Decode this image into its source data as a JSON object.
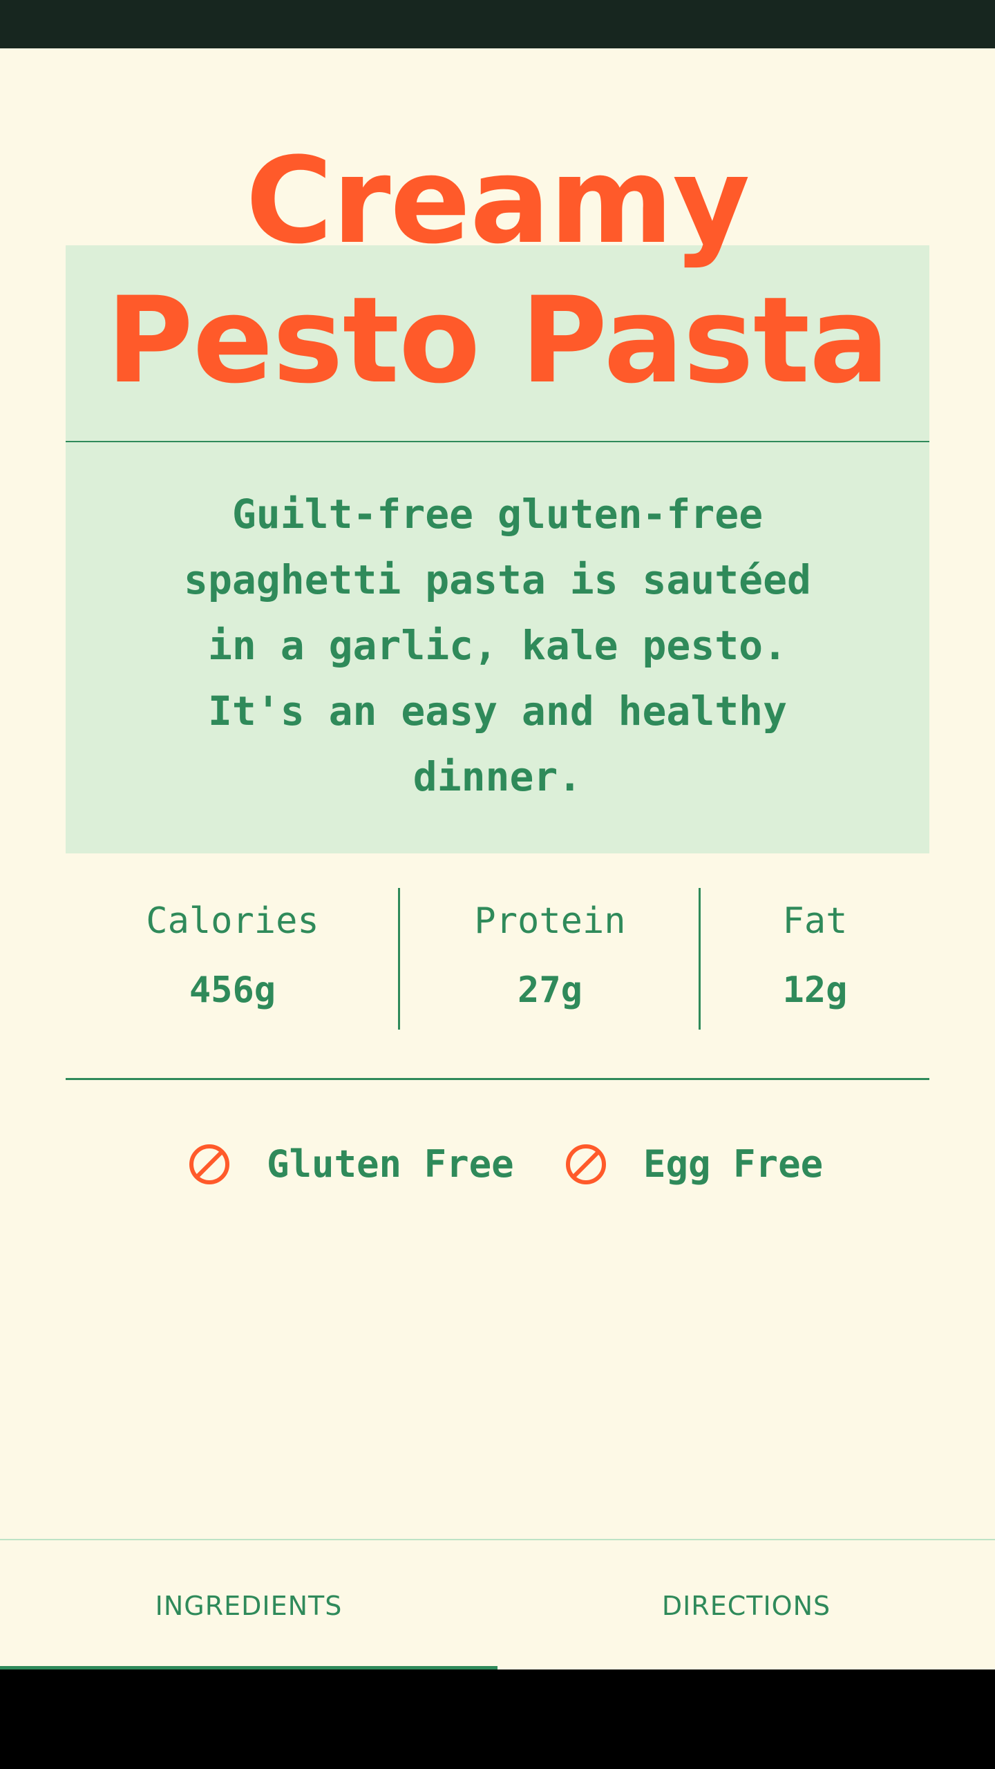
{
  "recipe": {
    "title": "Creamy Pesto Pasta",
    "description": "Guilt-free gluten-free spaghetti pasta is sautéed in a garlic, kale pesto. It's an easy and healthy dinner."
  },
  "nutrition": [
    {
      "label": "Calories",
      "value": "456g"
    },
    {
      "label": "Protein",
      "value": "27g"
    },
    {
      "label": "Fat",
      "value": "12g"
    }
  ],
  "dietary_tags": [
    {
      "icon": "no-symbol-icon",
      "label": "Gluten Free"
    },
    {
      "icon": "no-symbol-icon",
      "label": "Egg Free"
    }
  ],
  "tabs": [
    {
      "label": "INGREDIENTS",
      "selected": true
    },
    {
      "label": "DIRECTIONS",
      "selected": false
    }
  ],
  "colors": {
    "accent": "#ff5a2a",
    "primary": "#2f8a5a",
    "background": "#fdf9e6",
    "hero": "#dcefd8",
    "status_bar": "#17261f"
  }
}
